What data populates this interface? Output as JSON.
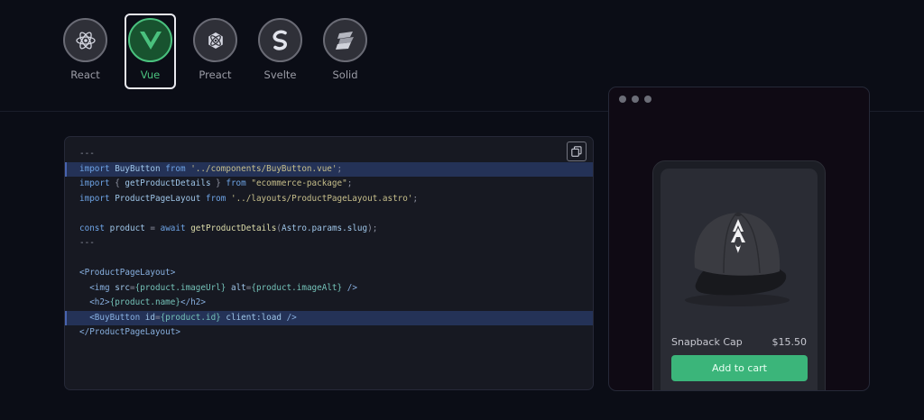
{
  "frameworks": [
    {
      "label": "React",
      "icon": "react-icon",
      "active": false
    },
    {
      "label": "Vue",
      "icon": "vue-icon",
      "active": true
    },
    {
      "label": "Preact",
      "icon": "preact-icon",
      "active": false
    },
    {
      "label": "Svelte",
      "icon": "svelte-icon",
      "active": false
    },
    {
      "label": "Solid",
      "icon": "solid-icon",
      "active": false
    }
  ],
  "code": {
    "copy_icon": "copy-icon",
    "lines": [
      "---",
      "import BuyButton from '../components/BuyButton.vue';",
      "import { getProductDetails } from \"ecommerce-package\";",
      "import ProductPageLayout from '../layouts/ProductPageLayout.astro';",
      "",
      "const product = await getProductDetails(Astro.params.slug);",
      "---",
      "",
      "<ProductPageLayout>",
      "  <img src={product.imageUrl} alt={product.imageAlt} />",
      "  <h2>{product.name}</h2>",
      "  <BuyButton id={product.id} client:load />",
      "</ProductPageLayout>"
    ],
    "highlighted_lines": [
      1,
      11
    ]
  },
  "preview": {
    "product_name": "Snapback Cap",
    "product_price": "$15.50",
    "button_label": "Add to cart",
    "image_icon": "cap-image"
  },
  "colors": {
    "accent": "#4ac17e",
    "button": "#3bb57a",
    "highlight": "#243257",
    "background": "#0b0d16"
  }
}
